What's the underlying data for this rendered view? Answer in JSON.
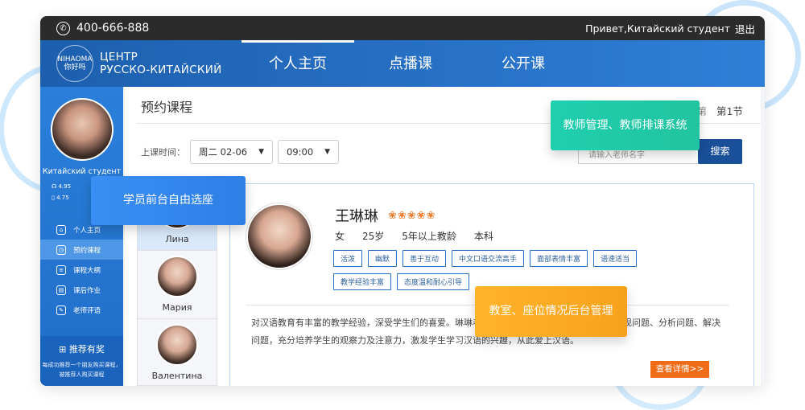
{
  "topbar": {
    "phone": "400-666-888",
    "greeting": "Привет,Китайский студент",
    "logout": "退出"
  },
  "logo": {
    "mark": "NIHAOMA 你好吗",
    "line1": "ЦЕНТР",
    "line2": "РУССКО-КИТАЙСКИЙ"
  },
  "nav": [
    {
      "label": "个人主页"
    },
    {
      "label": "点播课"
    },
    {
      "label": "公开课"
    }
  ],
  "sidebar": {
    "name": "Китайский студент",
    "stats": [
      "4.95",
      "4.75"
    ],
    "menu": [
      {
        "label": "个人主页",
        "icon": "home-icon"
      },
      {
        "label": "预约课程",
        "icon": "clock-icon"
      },
      {
        "label": "课程大纲",
        "icon": "list-icon"
      },
      {
        "label": "课后作业",
        "icon": "document-icon"
      },
      {
        "label": "老师评语",
        "icon": "comment-icon"
      }
    ],
    "promo": {
      "title": "推荐有奖",
      "desc": "每成功推荐一个朋友购买课程，被推荐人购买课程"
    }
  },
  "main": {
    "title": "预约课程",
    "lesson_prev": "第",
    "lesson": "第1节",
    "time_label": "上课时间：",
    "date_value": "周二  02-06",
    "time_value": "09:00",
    "search_placeholder": "请输入老师名字",
    "search_button": "搜索"
  },
  "teachers": [
    {
      "name": "Лина"
    },
    {
      "name": "Мария"
    },
    {
      "name": "Валентина"
    }
  ],
  "detail": {
    "name": "王琳琳",
    "rating": "❀❀❀❀❀",
    "gender": "女",
    "age": "25岁",
    "experience": "5年以上教龄",
    "degree": "本科",
    "tags": [
      "活泼",
      "幽默",
      "善于互动",
      "中文口语交流高手",
      "面部表情丰富",
      "语速适当",
      "教学经验丰富",
      "态度温和耐心引导"
    ],
    "desc": "对汉语教育有丰富的教学经验，深受学生们的喜爱。琳琳老师擅长采用启发式教学，引导学生发现问题、分析问题、解决问题，充分培养学生的观察力及注意力，激发学生学习汉语的兴趣，从此爱上汉语。",
    "more": "查看详情>>"
  },
  "callouts": {
    "student": "学员前台自由选座",
    "teacher": "教师管理、教师排课系统",
    "room": "教室、座位情况后台管理"
  }
}
